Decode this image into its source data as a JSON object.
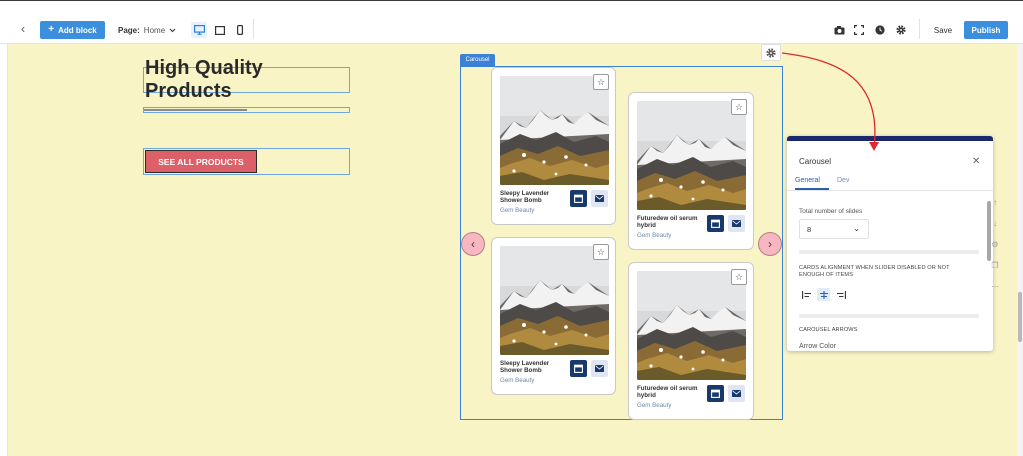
{
  "toolbar": {
    "add_block_label": "Add block",
    "page_label": "Page:",
    "page_value": "Home",
    "save_label": "Save",
    "publish_label": "Publish"
  },
  "content": {
    "heading": "High Quality Products",
    "divider_progress": 0.5,
    "cta_label": "SEE ALL PRODUCTS"
  },
  "carousel": {
    "tag": "Carousel",
    "cards": [
      {
        "title": "Sleepy Lavender Shower Bomb",
        "brand": "Gem Beauty"
      },
      {
        "title": "Futuredew oil serum hybrid",
        "brand": "Gem Beauty"
      },
      {
        "title": "Sleepy Lavender Shower Bomb",
        "brand": "Gem Beauty"
      },
      {
        "title": "Futuredew oil serum hybrid",
        "brand": "Gem Beauty"
      }
    ]
  },
  "panel": {
    "title": "Carousel",
    "tabs": [
      "General",
      "Dev"
    ],
    "total_slides_label": "Total number of slides",
    "total_slides_value": "8",
    "cards_alignment_label": "CARDS ALIGNMENT WHEN SLIDER DISABLED OR NOT ENOUGH OF ITEMS",
    "carousel_arrows_label": "CAROUSEL ARROWS",
    "arrow_color_label": "Arrow Color"
  },
  "colors": {
    "canvas_bg": "#f8f4c6",
    "primary_blue": "#3b8fdc",
    "cta_red": "#dc6067",
    "panel_accent": "#1b2a6e",
    "annotation_red": "#e0282e"
  },
  "icons": [
    "back-icon",
    "plus-icon",
    "chevron-down-icon",
    "desktop-icon",
    "tablet-icon",
    "mobile-icon",
    "camera-icon",
    "fullscreen-icon",
    "history-icon",
    "gear-icon",
    "star-icon",
    "calendar-icon",
    "mail-icon",
    "close-icon"
  ]
}
